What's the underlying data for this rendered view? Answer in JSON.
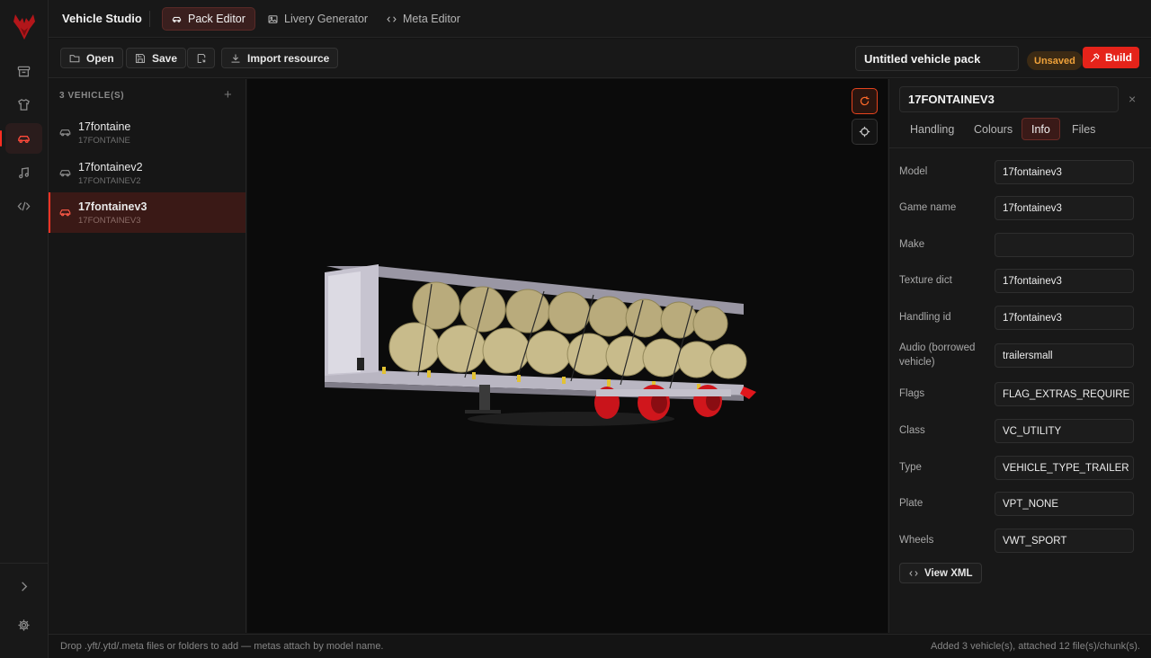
{
  "colors": {
    "accent": "#e5231a",
    "unsaved": "#f0a23a"
  },
  "nav": {
    "items": [
      {
        "name": "archive-icon"
      },
      {
        "name": "shirt-icon"
      },
      {
        "name": "car-icon",
        "active": true
      },
      {
        "name": "music-icon"
      },
      {
        "name": "code-icon"
      }
    ],
    "bottom": [
      {
        "name": "chevron-right-icon"
      },
      {
        "name": "gear-icon"
      }
    ]
  },
  "header": {
    "app_title": "Vehicle Studio",
    "tabs": [
      {
        "label": "Pack Editor",
        "icon": "car-icon",
        "active": true
      },
      {
        "label": "Livery Generator",
        "icon": "image-icon"
      },
      {
        "label": "Meta Editor",
        "icon": "code-icon"
      }
    ]
  },
  "toolbar": {
    "open_label": "Open",
    "save_label": "Save",
    "import_label": "Import resource",
    "pack_name": "Untitled vehicle pack",
    "status_badge": "Unsaved",
    "build_label": "Build"
  },
  "vehicles": {
    "header": "3 VEHICLE(S)",
    "add": "+",
    "items": [
      {
        "name": "17fontaine",
        "sub": "17FONTAINE"
      },
      {
        "name": "17fontainev2",
        "sub": "17FONTAINEV2"
      },
      {
        "name": "17fontainev3",
        "sub": "17FONTAINEV3",
        "active": true
      }
    ]
  },
  "panel": {
    "title": "17FONTAINEV3",
    "close": "×",
    "tabs": [
      "Handling",
      "Colours",
      "Info",
      "Files"
    ],
    "active_tab": "Info",
    "fields": [
      {
        "label": "Model",
        "value": "17fontainev3"
      },
      {
        "label": "Game name",
        "value": "17fontainev3"
      },
      {
        "label": "Make",
        "value": ""
      },
      {
        "label": "Texture dict",
        "value": "17fontainev3"
      },
      {
        "label": "Handling id",
        "value": "17fontainev3"
      },
      {
        "label": "Audio (borrowed vehicle)",
        "value": "trailersmall"
      },
      {
        "label": "Flags",
        "value": "FLAG_EXTRAS_REQUIRE FLAG"
      },
      {
        "label": "Class",
        "value": "VC_UTILITY"
      },
      {
        "label": "Type",
        "value": "VEHICLE_TYPE_TRAILER"
      },
      {
        "label": "Plate",
        "value": "VPT_NONE"
      },
      {
        "label": "Wheels",
        "value": "VWT_SPORT"
      }
    ],
    "view_xml": "View XML"
  },
  "status": {
    "left": "Drop .yft/.ytd/.meta files or folders to add — metas attach by model name.",
    "right": "Added 3 vehicle(s), attached 12 file(s)/chunk(s)."
  }
}
